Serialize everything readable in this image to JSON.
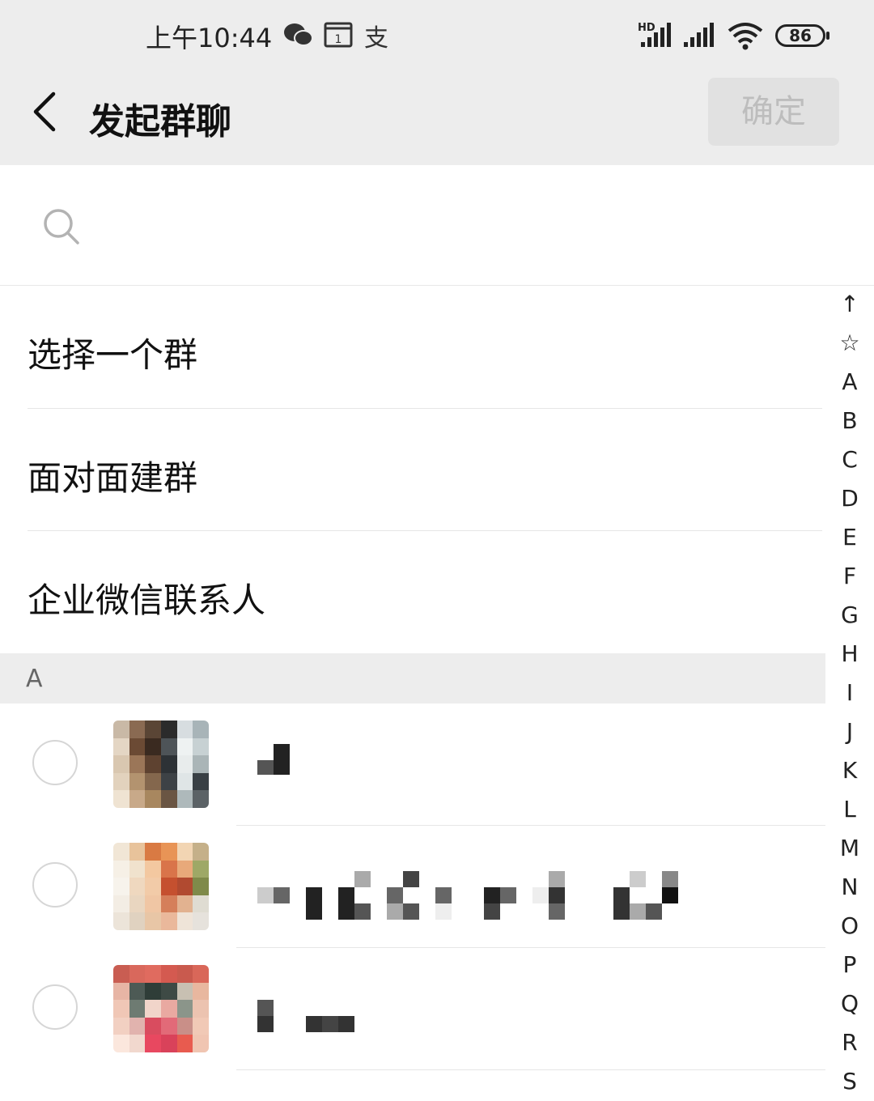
{
  "status_bar": {
    "time": "上午10:44",
    "notif_icons": [
      "wechat-icon",
      "calendar-icon",
      "alipay-icon"
    ],
    "calendar_day": "1",
    "alipay_glyph": "支",
    "network_label": "HD",
    "battery": "86"
  },
  "header": {
    "back_icon": "chevron-left-icon",
    "title": "发起群聊",
    "confirm_label": "确定"
  },
  "search": {
    "icon": "search-icon",
    "placeholder": ""
  },
  "options": [
    {
      "label": "选择一个群"
    },
    {
      "label": "面对面建群"
    },
    {
      "label": "企业微信联系人"
    }
  ],
  "section": {
    "letter": "A"
  },
  "contacts": [
    {
      "name": "",
      "checked": false
    },
    {
      "name": "",
      "checked": false
    },
    {
      "name": "",
      "checked": false
    }
  ],
  "index_bar": [
    "↑",
    "☆",
    "A",
    "B",
    "C",
    "D",
    "E",
    "F",
    "G",
    "H",
    "I",
    "J",
    "K",
    "L",
    "M",
    "N",
    "O",
    "P",
    "Q",
    "R",
    "S"
  ],
  "colors": {
    "header_bg": "#ededed",
    "confirm_disabled_bg": "#e1e1e1",
    "confirm_disabled_text": "#bdbdbd"
  }
}
